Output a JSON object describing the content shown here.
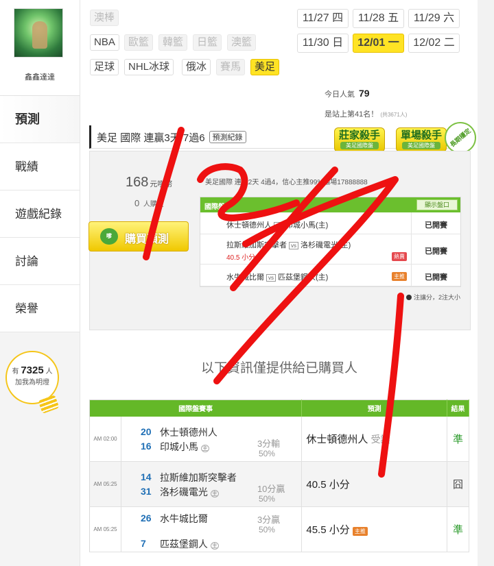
{
  "user": {
    "name": "鑫鑫達達"
  },
  "nav": [
    "預測",
    "戰績",
    "遊戲紀錄",
    "討論",
    "榮譽"
  ],
  "fans": {
    "prefix": "有",
    "count": "7325",
    "suffix": "人",
    "line2": "加我為明燈"
  },
  "sports": [
    {
      "label": "澳棒",
      "state": "dim"
    },
    {
      "label": "NBA",
      "state": "normal"
    },
    {
      "label": "歐籃",
      "state": "dim"
    },
    {
      "label": "韓籃",
      "state": "dim"
    },
    {
      "label": "日籃",
      "state": "dim"
    },
    {
      "label": "澳籃",
      "state": "dim"
    },
    {
      "label": "足球",
      "state": "normal"
    },
    {
      "label": "NHL冰球",
      "state": "normal"
    },
    {
      "label": "俄冰",
      "state": "normal"
    },
    {
      "label": "賽馬",
      "state": "dim"
    },
    {
      "label": "美足",
      "state": "selected"
    }
  ],
  "dates": [
    {
      "label": "11/27 四",
      "selected": false
    },
    {
      "label": "11/28 五",
      "selected": false
    },
    {
      "label": "11/29 六",
      "selected": false
    },
    {
      "label": "11/30 日",
      "selected": false
    },
    {
      "label": "12/01 一",
      "selected": true
    },
    {
      "label": "12/02 二",
      "selected": false
    }
  ],
  "stats": {
    "popularity_label": "今日人氣",
    "popularity_value": "79",
    "rank_text": "是站上第41名！",
    "rank_note": "(共3671人)"
  },
  "title": {
    "text": "美足 國際 連贏3天 7過6",
    "record_button": "預測紀錄",
    "medal1": "莊家殺手",
    "medal1_sub": "美足國際盤",
    "medal2": "單場殺手",
    "medal2_sub": "美足國際盤",
    "ribbon": "長期穩定"
  },
  "buy": {
    "price": "168",
    "price_unit": "元嗲幣",
    "buyers": "0",
    "buyers_unit": "人購買",
    "button": "購買預測",
    "icon": "buy-coin-icon",
    "summary": "美足國際 連贏2天 4過4，信心主推99%貓場17888888"
  },
  "intl": {
    "header": "國際盤",
    "show_button": "顯示盤口",
    "rows": [
      {
        "away": "休士頓德州人",
        "home": "印城小馬(主)",
        "line": "",
        "tag": "",
        "status": "已開賽"
      },
      {
        "away": "拉斯維加斯突擊者",
        "home": "洛杉磯電光(主)",
        "line": "40.5 小分",
        "tag": "熱賣",
        "status": "已開賽"
      },
      {
        "away": "水牛城比爾",
        "home": "匹茲堡鋼人(主)",
        "line": "",
        "tag": "主推",
        "status": "已開賽"
      }
    ],
    "note": "注讓分，2注大小"
  },
  "info_line": "以下資訊僅提供給已購買人",
  "results": {
    "headers": [
      "國際盤賽事",
      "預測",
      "結果"
    ],
    "rows": [
      {
        "time": "AM 02:00",
        "s1": "20",
        "t1": "休士頓德州人",
        "s2": "16",
        "t2": "印城小馬",
        "home": "主",
        "line": "3分輸",
        "pct": "50%",
        "pick": "休士頓德州人",
        "pick_sub": "受讓",
        "tag": "",
        "result": "準"
      },
      {
        "time": "AM 05:25",
        "s1": "14",
        "t1": "拉斯維加斯突擊者",
        "s2": "31",
        "t2": "洛杉磯電光",
        "home": "主",
        "line": "10分贏",
        "pct": "50%",
        "pick": "40.5 小分",
        "pick_sub": "",
        "tag": "",
        "result": "囧"
      },
      {
        "time": "AM 05:25",
        "s1": "26",
        "t1": "水牛城比爾",
        "s2": "7",
        "t2": "匹茲堡鋼人",
        "home": "主",
        "line": "3分贏",
        "pct": "50%",
        "pick": "45.5 小分",
        "pick_sub": "",
        "tag": "主推",
        "result": "準"
      }
    ]
  },
  "colors": {
    "accent_green": "#64b828",
    "accent_yellow": "#ffe324",
    "marker_red": "#ee1111"
  }
}
